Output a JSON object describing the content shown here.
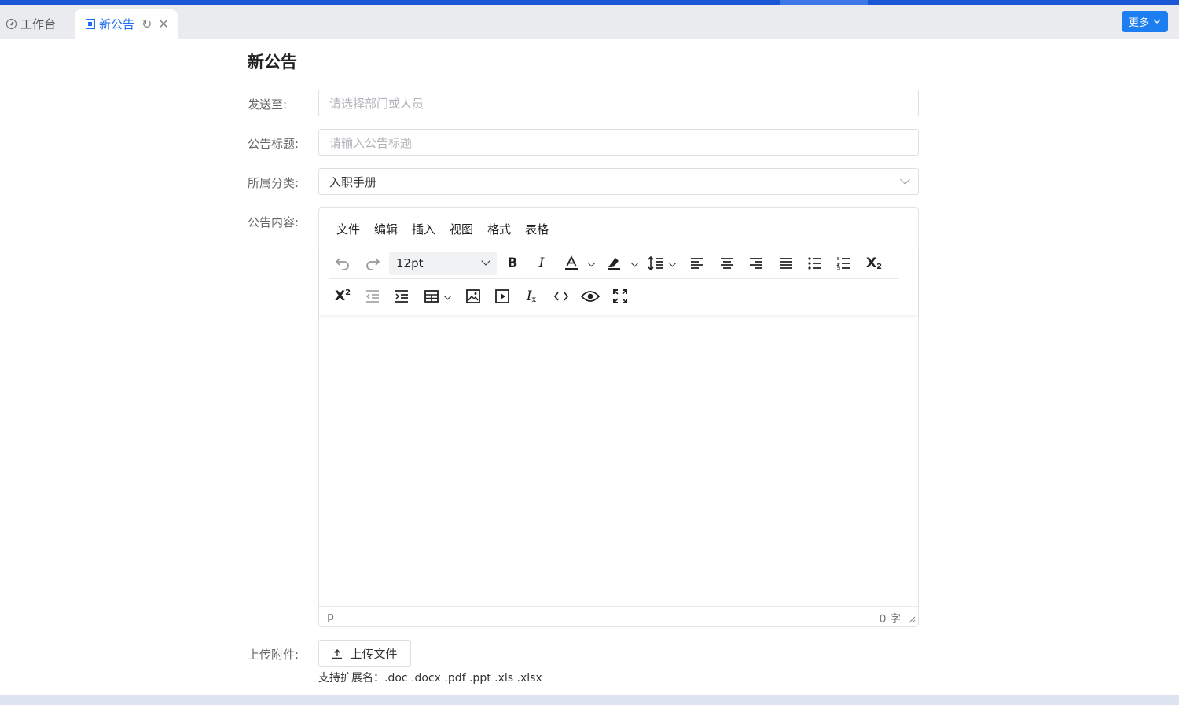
{
  "tabs": {
    "home_label": "工作台",
    "active_label": "新公告",
    "more_label": "更多"
  },
  "form": {
    "title": "新公告",
    "send_to": {
      "label": "发送至:",
      "placeholder": "请选择部门或人员"
    },
    "notice_title": {
      "label": "公告标题:",
      "placeholder": "请输入公告标题"
    },
    "category": {
      "label": "所属分类:",
      "value": "入职手册"
    },
    "content": {
      "label": "公告内容:"
    },
    "attachment": {
      "label": "上传附件:",
      "button_label": "上传文件",
      "hint": "支持扩展名：.doc .docx .pdf .ppt .xls .xlsx"
    }
  },
  "editor": {
    "menus": [
      "文件",
      "编辑",
      "插入",
      "视图",
      "格式",
      "表格"
    ],
    "font_size": "12pt",
    "status_path": "p",
    "word_count": "0 字"
  },
  "icons": {
    "undo": "undo-icon",
    "redo": "redo-icon",
    "bold": "bold-icon",
    "italic": "italic-icon",
    "text_color": "text-color-icon",
    "highlight": "highlight-icon",
    "line_height": "line-height-icon",
    "align_left": "align-left-icon",
    "align_center": "align-center-icon",
    "align_right": "align-right-icon",
    "justify": "justify-icon",
    "bullet_list": "bullet-list-icon",
    "numbered_list": "numbered-list-icon",
    "subscript": "subscript-icon",
    "superscript": "superscript-icon",
    "outdent": "outdent-icon",
    "indent": "indent-icon",
    "table": "table-icon",
    "image": "image-icon",
    "media": "media-icon",
    "clear_format": "clear-format-icon",
    "code": "code-icon",
    "preview": "preview-icon",
    "fullscreen": "fullscreen-icon"
  },
  "colors": {
    "primary": "#1d7ef2",
    "accent_bar": "#1c58d6",
    "active_tab_text": "#1d6ff0"
  }
}
